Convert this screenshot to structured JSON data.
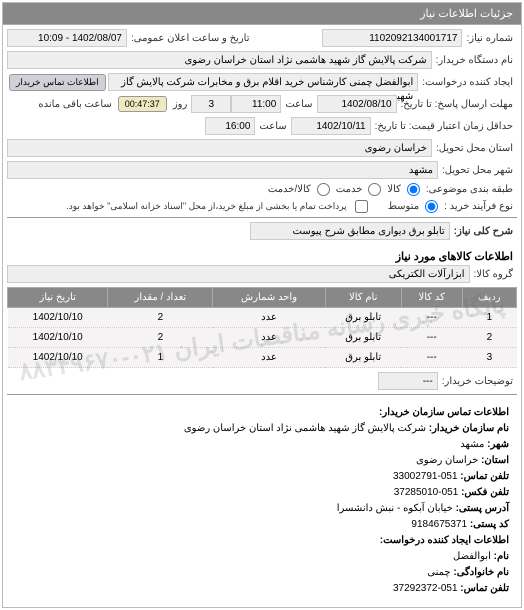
{
  "panel": {
    "title": "جزئیات اطلاعات نیاز"
  },
  "header": {
    "need_no_label": "شماره نیاز:",
    "need_no": "1102092134001717",
    "announce_label": "تاریخ و ساعت اعلان عمومی:",
    "announce_value": "1402/08/07 - 10:09",
    "buyer_org_label": "نام دستگاه خریدار:",
    "buyer_org": "شرکت پالایش گاز شهید هاشمی نژاد    استان خراسان رضوی",
    "requester_label": "ایجاد کننده درخواست:",
    "requester": "ابوالفضل چمنی کارشناس خرید اقلام برق و مخابرات شرکت پالایش گاز شهید ه",
    "contact_btn": "اطلاعات تماس خریدار",
    "reply_deadline_label": "مهلت ارسال پاسخ: تا تاریخ:",
    "reply_date": "1402/08/10",
    "time_label": "ساعت",
    "reply_time": "11:00",
    "days_extend": "3",
    "days_extend_label": "روز",
    "remaining_btn": "00:47:37",
    "remaining_label": "ساعت باقی مانده",
    "validity_label": "حداقل زمان اعتبار قیمت: تا تاریخ:",
    "validity_date": "1402/10/11",
    "validity_time": "16:00",
    "delivery_province_label": "استان محل تحویل:",
    "delivery_province": "خراسان رضوی",
    "delivery_city_label": "شهر محل تحویل:",
    "delivery_city": "مشهد",
    "subject_class_label": "طبقه بندی موضوعی:",
    "radio_goods": "کالا",
    "radio_service": "خدمت",
    "radio_both": "کالا/خدمت",
    "buy_type_label": "نوع فرآیند خرید :",
    "radio_medium": "متوسط",
    "buy_note": "پرداخت تمام یا بخشی از مبلغ خرید،از محل \"اسناد خزانه اسلامی\" خواهد بود.",
    "overall_desc_label": "شرح کلی نیاز:",
    "overall_desc": "تابلو برق دیواری مطابق شرح پیوست"
  },
  "goods": {
    "section_title": "اطلاعات کالاهای مورد نیاز",
    "group_label": "گروه کالا:",
    "group_value": "ابزارآلات الکتریکی",
    "columns": {
      "row": "ردیف",
      "code": "کد کالا",
      "name": "نام کالا",
      "unit": "واحد شمارش",
      "qty": "تعداد / مقدار",
      "need_date": "تاریخ نیاز"
    },
    "rows": [
      {
        "idx": "1",
        "code": "---",
        "name": "تابلو برق",
        "unit": "عدد",
        "qty": "2",
        "date": "1402/10/10"
      },
      {
        "idx": "2",
        "code": "---",
        "name": "تابلو برق",
        "unit": "عدد",
        "qty": "2",
        "date": "1402/10/10"
      },
      {
        "idx": "3",
        "code": "---",
        "name": "تابلو برق",
        "unit": "عدد",
        "qty": "1",
        "date": "1402/10/10"
      }
    ],
    "buyer_notes_label": "توضیحات خریدار:",
    "buyer_notes": "---"
  },
  "watermark": "پایگاه خبری رسانه مناقصات ایران\n۰۲۱-۸۸۳۴۹۶۷۰",
  "contact": {
    "org_section": "اطلاعات تماس سازمان خریدار:",
    "org_name_label": "نام سازمان خریدار:",
    "org_name": "شرکت پالایش گاز شهید هاشمی نژاد استان خراسان رضوی",
    "city_label": "شهر:",
    "city": "مشهد",
    "province_label": "استان:",
    "province": "خراسان رضوی",
    "phone_label": "تلفن تماس:",
    "phone": "051-33002791",
    "fax_label": "تلفن فکس:",
    "fax": "051-37285010",
    "address_label": "آدرس پستی:",
    "address": "خیابان آبکوه - نبش دانشسرا",
    "postal_label": "کد پستی:",
    "postal": "9184675371",
    "creator_section": "اطلاعات ایجاد کننده درخواست:",
    "fname_label": "نام:",
    "fname": "ابوالفضل",
    "lname_label": "نام خانوادگی:",
    "lname": "چمنی",
    "creator_phone_label": "تلفن تماس:",
    "creator_phone": "051-37292372"
  }
}
